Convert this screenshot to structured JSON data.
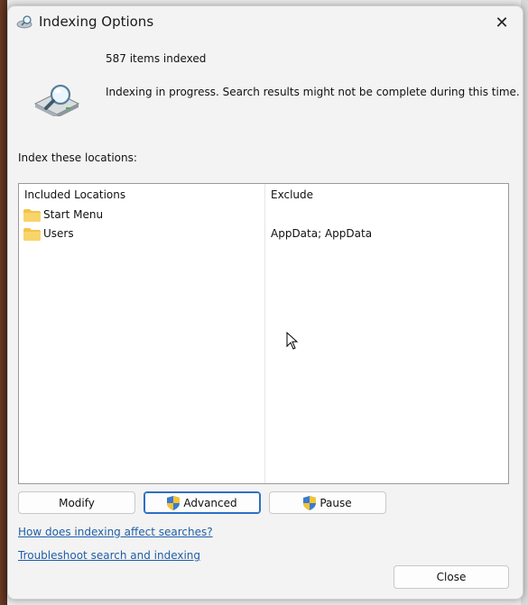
{
  "window": {
    "title": "Indexing Options",
    "close_glyph": "✕"
  },
  "status": {
    "items_indexed": "587 items indexed",
    "message": "Indexing in progress. Search results might not be complete during this time."
  },
  "locations_label": "Index these locations:",
  "table": {
    "columns": [
      "Included Locations",
      "Exclude"
    ],
    "rows": [
      {
        "location": "Start Menu",
        "exclude": ""
      },
      {
        "location": "Users",
        "exclude": "AppData; AppData"
      }
    ]
  },
  "buttons": {
    "modify": "Modify",
    "advanced": "Advanced",
    "pause": "Pause",
    "close": "Close"
  },
  "links": {
    "how_indexing": "How does indexing affect searches?",
    "troubleshoot": "Troubleshoot search and indexing"
  },
  "colors": {
    "link": "#1f5ea8",
    "focus_border": "#2c6fc5",
    "folder": "#f2c44d"
  },
  "icons": {
    "title": "indexing-options-icon",
    "status": "drive-magnifier-icon",
    "folder": "folder-icon",
    "shield": "uac-shield-icon"
  }
}
